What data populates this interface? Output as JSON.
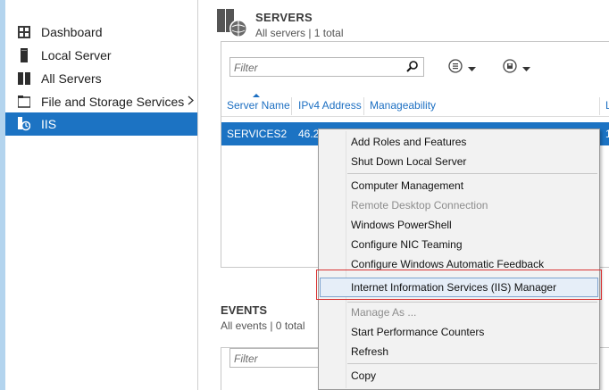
{
  "sidebar": {
    "items": [
      {
        "label": "Dashboard",
        "icon": "dashboard-icon"
      },
      {
        "label": "Local Server",
        "icon": "server-icon"
      },
      {
        "label": "All Servers",
        "icon": "servers-icon"
      },
      {
        "label": "File and Storage Services",
        "icon": "storage-icon"
      },
      {
        "label": "IIS",
        "icon": "iis-icon"
      }
    ],
    "selected": "IIS"
  },
  "servers": {
    "title": "SERVERS",
    "subtitle": "All servers | 1 total",
    "filter_placeholder": "Filter",
    "columns": [
      "Server Name",
      "IPv4 Address",
      "Manageability",
      "L"
    ],
    "rows": [
      {
        "server_name": "SERVICES2",
        "ipv4": "46.2",
        "extra": "1"
      }
    ]
  },
  "events": {
    "title": "EVENTS",
    "subtitle": "All events | 0 total",
    "filter_placeholder": "Filter"
  },
  "context_menu": {
    "items": [
      {
        "label": "Add Roles and Features",
        "enabled": true
      },
      {
        "label": "Shut Down Local Server",
        "enabled": true
      },
      {
        "label": "Computer Management",
        "enabled": true
      },
      {
        "label": "Remote Desktop Connection",
        "enabled": false
      },
      {
        "label": "Windows PowerShell",
        "enabled": true
      },
      {
        "label": "Configure NIC Teaming",
        "enabled": true
      },
      {
        "label": "Configure Windows Automatic Feedback",
        "enabled": true
      },
      {
        "label": "Internet Information Services (IIS) Manager",
        "enabled": true,
        "highlighted": true
      },
      {
        "label": "Manage As ...",
        "enabled": false
      },
      {
        "label": "Start Performance Counters",
        "enabled": true
      },
      {
        "label": "Refresh",
        "enabled": true
      },
      {
        "label": "Copy",
        "enabled": true
      }
    ]
  },
  "colors": {
    "selection": "#1c73c3",
    "link": "#1c6fc2",
    "highlight_box": "#d93232",
    "accent_strip": "#b3d4ee"
  }
}
